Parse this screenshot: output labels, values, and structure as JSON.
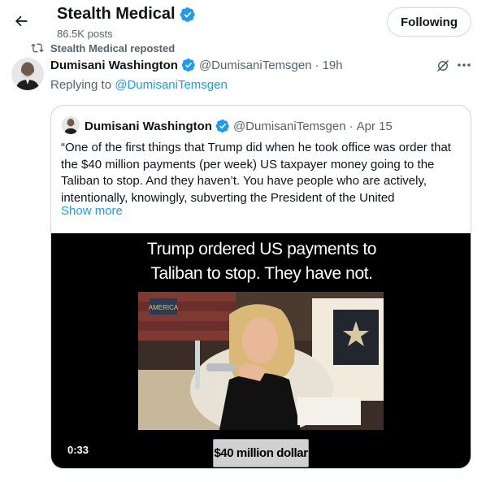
{
  "header": {
    "title": "Stealth Medical",
    "posts_count": "86.5K posts",
    "follow_button": "Following"
  },
  "repost": {
    "label": "Stealth Medical reposted"
  },
  "post": {
    "author_name": "Dumisani Washington",
    "author_handle": "@DumisaniTemsgen",
    "separator": "·",
    "time": "19h",
    "replying_prefix": "Replying to ",
    "replying_to": "@DumisaniTemsgen"
  },
  "quote": {
    "author_name": "Dumisani Washington",
    "author_handle": "@DumisaniTemsgen",
    "separator": "·",
    "date": "Apr 15",
    "text": "“One of the first things that Trump did when he took office was order that the $40 million payments (per week) US taxpayer money going to the Taliban to stop. And they haven’t. You have people who are actively, intentionally, knowingly, subverting the President of the United",
    "show_more": "Show more"
  },
  "video": {
    "caption_line1": "Trump ordered US payments to",
    "caption_line2": "Taliban to stop. They have not.",
    "duration": "0:33",
    "lower_third": "$40 million dollar",
    "logo_text": "AMERICA"
  },
  "colors": {
    "accent": "#1d9bf0",
    "text": "#0f1419",
    "muted": "#536471",
    "border": "#cfd9de"
  },
  "icons": [
    "back-arrow-icon",
    "verified-badge-icon",
    "repost-icon",
    "grok-icon",
    "more-icon"
  ]
}
